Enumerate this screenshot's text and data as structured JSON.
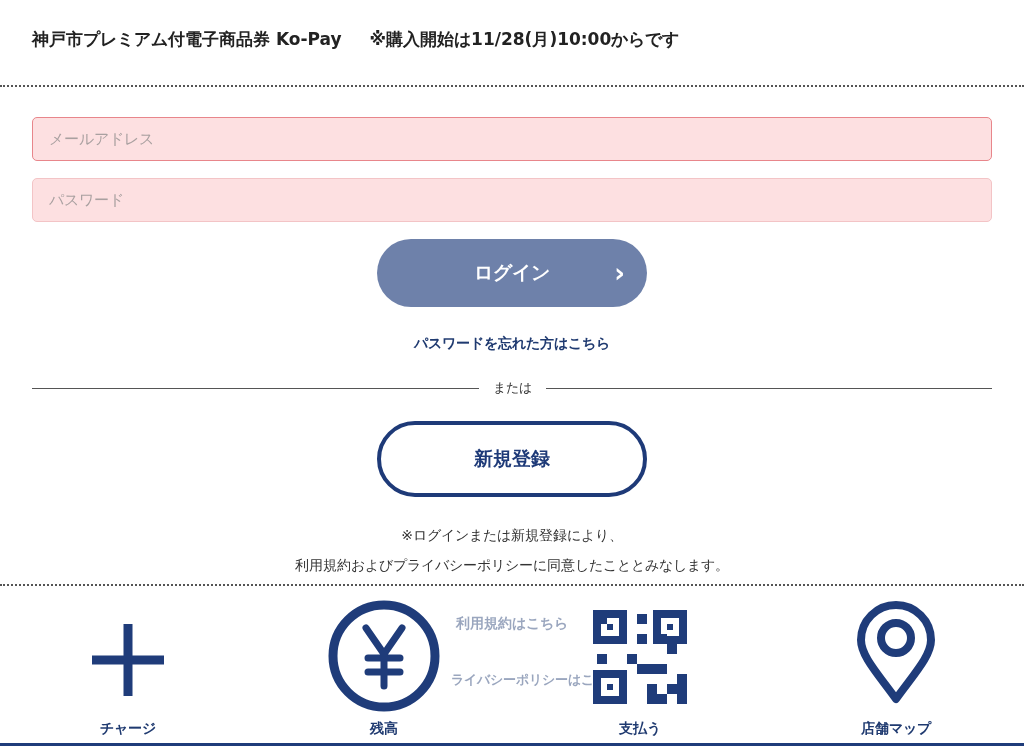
{
  "header": {
    "title": "神戸市プレミアム付電子商品券 Ko-Pay",
    "notice": "※購入開始は11/28(月)10:00からです"
  },
  "fields": [
    {
      "placeholder": "メールアドレス",
      "error": true
    },
    {
      "placeholder": "パスワード",
      "error": false
    }
  ],
  "login_button": {
    "label": "ログイン",
    "arrow": "›",
    "disabled": true
  },
  "forgot_link": "パスワードを忘れた方はこちら",
  "divider_text": "または",
  "register_button": "新規登録",
  "notes": [
    "※ログインまたは新規登録により、",
    "利用規約およびプライバシーポリシーに同意したこととみなします。"
  ],
  "links": [
    "利用規約はこちら",
    "ライバシーポリシーはこ"
  ],
  "bottom_nav": [
    {
      "kind": "plus",
      "label": "チャージ"
    },
    {
      "kind": "yen",
      "label": "残高"
    },
    {
      "kind": "qr",
      "label": "支払う"
    },
    {
      "kind": "pin",
      "label": "店舗マップ"
    }
  ]
}
